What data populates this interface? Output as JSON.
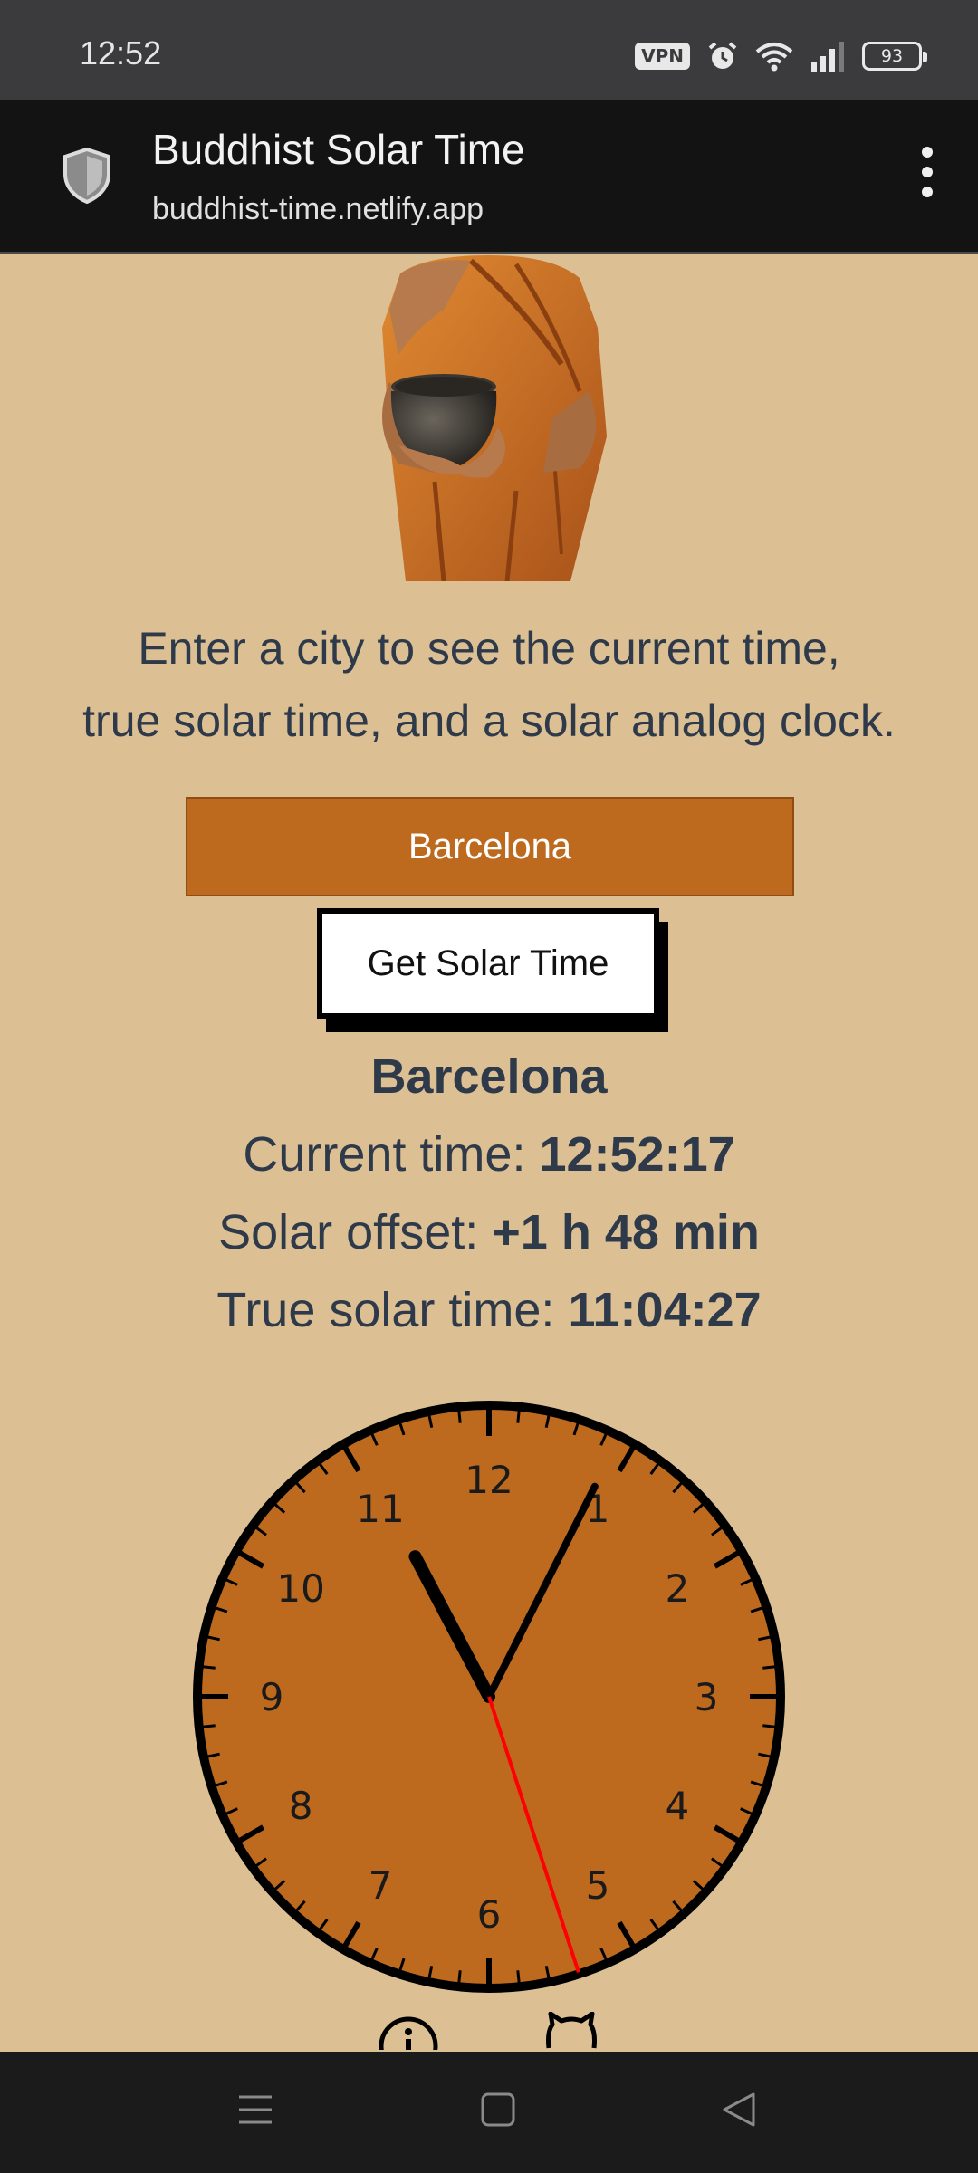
{
  "status_bar": {
    "time": "12:52",
    "vpn_label": "VPN",
    "battery_level": "93",
    "icons": [
      "vpn-icon",
      "alarm-icon",
      "wifi-icon",
      "signal-icon",
      "battery-icon"
    ]
  },
  "browser": {
    "title": "Buddhist Solar Time",
    "url": "buddhist-time.netlify.app",
    "icons": [
      "shield-icon",
      "more-vert-icon"
    ]
  },
  "intro": {
    "line1": "Enter a city to see the current time,",
    "line2": "true solar time, and a solar analog clock."
  },
  "form": {
    "city_value": "Barcelona",
    "button_label": "Get Solar Time"
  },
  "result": {
    "city": "Barcelona",
    "current_label": "Current time:",
    "current_value": "12:52:17",
    "offset_label": "Solar offset:",
    "offset_value": "+1 h 48 min",
    "solar_label": "True solar time:",
    "solar_value": "11:04:27"
  },
  "clock": {
    "numbers": [
      "12",
      "1",
      "2",
      "3",
      "4",
      "5",
      "6",
      "7",
      "8",
      "9",
      "10",
      "11"
    ],
    "time_shown": "11:04:27",
    "face_color": "#bd6a1f",
    "hand_color": "#000000",
    "second_hand_color": "#ff0000"
  },
  "footer": {
    "icons": [
      "info-icon",
      "github-icon"
    ]
  },
  "nav_bar": {
    "icons": [
      "menu-icon",
      "home-icon",
      "back-icon"
    ]
  },
  "colors": {
    "page_background": "#dcc094",
    "accent": "#bd6a1f",
    "text": "#2e3a4a"
  }
}
